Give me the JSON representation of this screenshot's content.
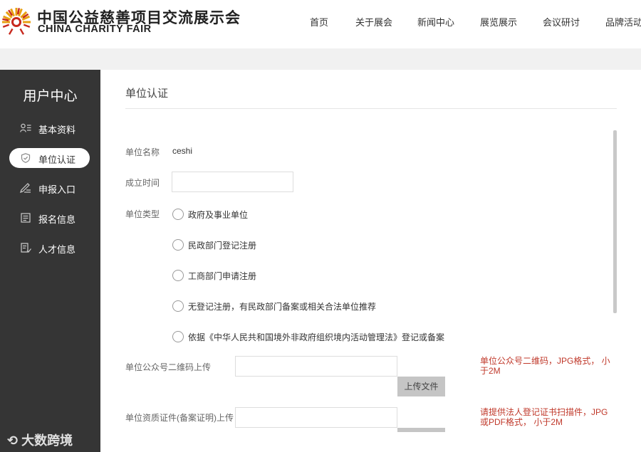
{
  "header": {
    "logo_cn": "中国公益慈善项目交流展示会",
    "logo_en": "CHINA CHARITY FAIR",
    "nav": [
      "首页",
      "关于展会",
      "新闻中心",
      "展览展示",
      "会议研讨",
      "品牌活动"
    ]
  },
  "sidebar": {
    "title": "用户中心",
    "items": [
      {
        "label": "基本资料",
        "icon": "user-list-icon"
      },
      {
        "label": "单位认证",
        "icon": "shield-icon"
      },
      {
        "label": "申报入口",
        "icon": "pen-icon"
      },
      {
        "label": "报名信息",
        "icon": "form-icon"
      },
      {
        "label": "人才信息",
        "icon": "document-icon"
      }
    ]
  },
  "watermark": "大数跨境",
  "main": {
    "title": "单位认证",
    "form": {
      "unit_name_label": "单位名称",
      "unit_name_value": "ceshi",
      "founded_label": "成立时间",
      "unit_type_label": "单位类型",
      "unit_types": [
        "政府及事业单位",
        "民政部门登记注册",
        "工商部门申请注册",
        "无登记注册，有民政部门备案或相关合法单位推荐",
        "依据《中华人民共和国境外非政府组织境内活动管理法》登记或备案"
      ],
      "qr_label": "单位公众号二维码上传",
      "qr_button": "上传文件",
      "qr_hint": "单位公众号二维码，JPG格式， 小于2M",
      "cert_label": "单位资质证件(备案证明)上传",
      "cert_hint": "请提供法人登记证书扫描件，JPG或PDF格式， 小于2M"
    }
  },
  "colors": {
    "sidebar_bg": "#353535",
    "hint": "#c0392b",
    "band": "#f1f1f1"
  }
}
